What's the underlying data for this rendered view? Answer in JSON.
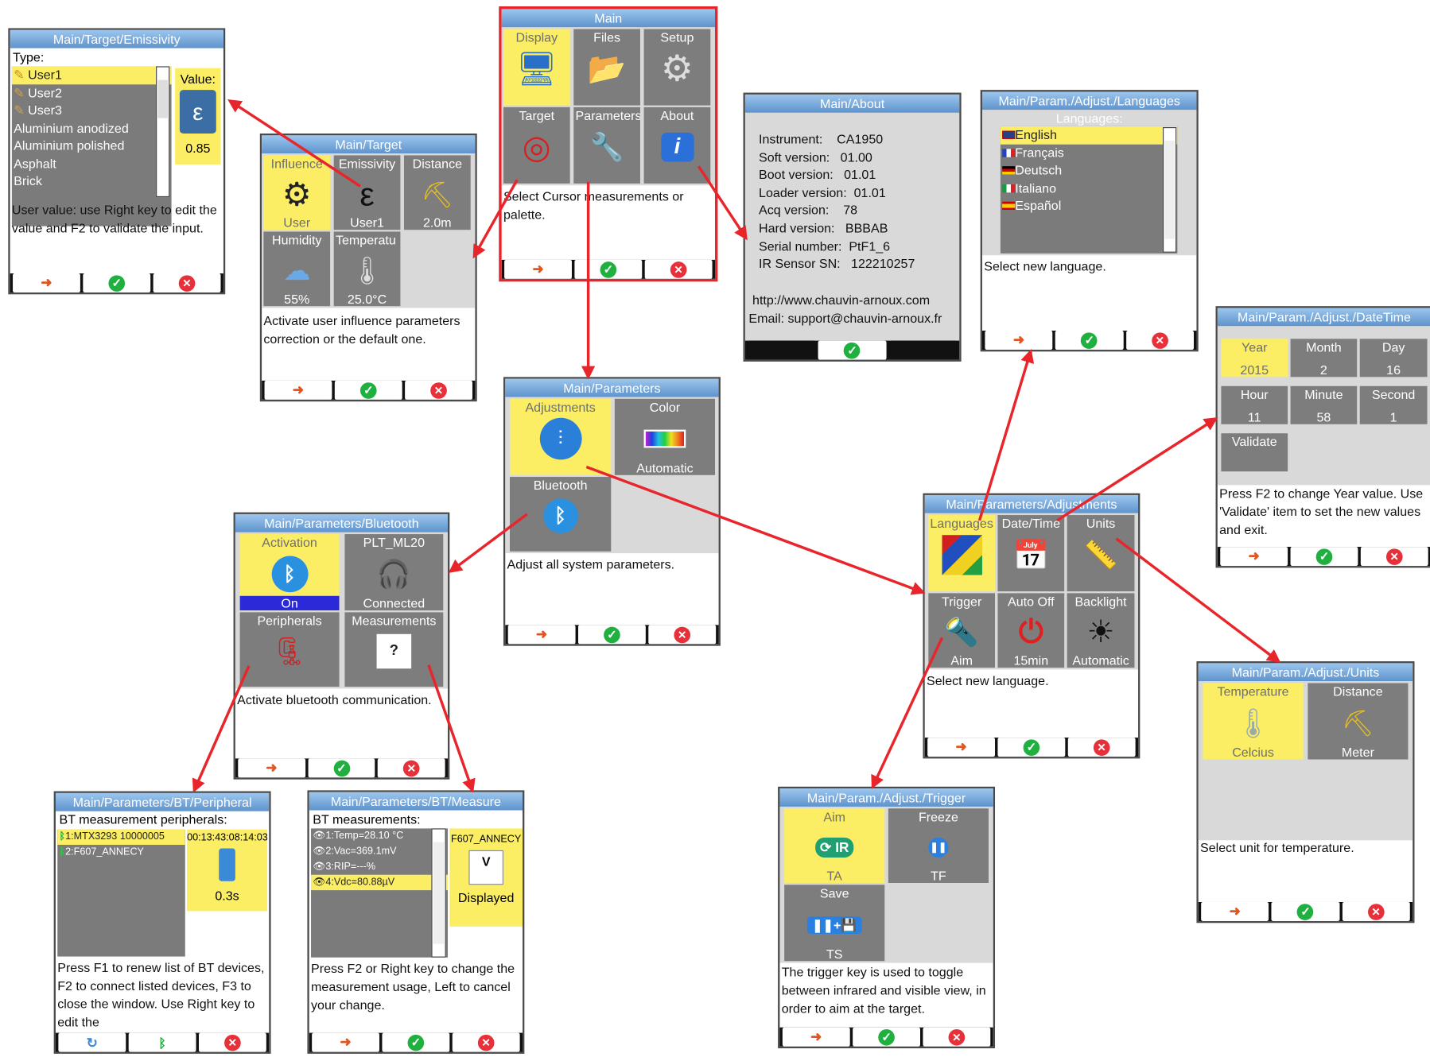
{
  "footer": {
    "exit": "exit-icon",
    "ok": "check-icon",
    "cancel": "cancel-icon",
    "refresh": "refresh-icon",
    "bt": "bluetooth-icon"
  },
  "main": {
    "title": "Main",
    "tiles": [
      {
        "label": "Display"
      },
      {
        "label": "Files"
      },
      {
        "label": "Setup"
      },
      {
        "label": "Target"
      },
      {
        "label": "Parameters"
      },
      {
        "label": "About"
      }
    ],
    "help": "Select Cursor measurements or palette."
  },
  "emissivity": {
    "title": "Main/Target/Emissivity",
    "type_label": "Type:",
    "items": [
      "User1",
      "User2",
      "User3",
      "Aluminium anodized",
      "Aluminium polished",
      "Asphalt",
      "Brick"
    ],
    "value_label": "Value:",
    "value": "0.85",
    "help": "User value: use Right key to edit the value and F2 to validate the input."
  },
  "target": {
    "title": "Main/Target",
    "tiles": [
      {
        "label": "Influence",
        "value": "User"
      },
      {
        "label": "Emissivity",
        "value": "User1"
      },
      {
        "label": "Distance",
        "value": "2.0m"
      },
      {
        "label": "Humidity",
        "value": "55%"
      },
      {
        "label": "Temperatu",
        "value": "25.0°C"
      }
    ],
    "help": "Activate user influence parameters correction or the default one."
  },
  "about": {
    "title": "Main/About",
    "lines": [
      "Instrument:    CA1950",
      "Soft version:   01.00",
      "Boot version:   01.01",
      "Loader version:  01.01",
      "Acq version:    78",
      "Hard version:   BBBAB",
      "Serial number:  PtF1_6",
      "IR Sensor SN:   122210257"
    ],
    "url": "http://www.chauvin-arnoux.com",
    "email": "Email: support@chauvin-arnoux.fr"
  },
  "languages": {
    "title": "Main/Param./Adjust./Languages",
    "header": "Languages:",
    "items": [
      "English",
      "Français",
      "Deutsch",
      "Italiano",
      "Español"
    ],
    "help": "Select new language."
  },
  "datetime": {
    "title": "Main/Param./Adjust./DateTime",
    "tiles": [
      {
        "label": "Year",
        "value": "2015"
      },
      {
        "label": "Month",
        "value": "2"
      },
      {
        "label": "Day",
        "value": "16"
      },
      {
        "label": "Hour",
        "value": "11"
      },
      {
        "label": "Minute",
        "value": "58"
      },
      {
        "label": "Second",
        "value": "1"
      },
      {
        "label": "Validate",
        "value": ""
      }
    ],
    "help": "Press F2 to change Year value. Use 'Validate' item to set the new values and exit."
  },
  "parameters": {
    "title": "Main/Parameters",
    "tiles": [
      {
        "label": "Adjustments",
        "value": ""
      },
      {
        "label": "Color",
        "value": "Automatic"
      },
      {
        "label": "Bluetooth",
        "value": ""
      }
    ],
    "help": "Adjust all system parameters."
  },
  "bluetooth": {
    "title": "Main/Parameters/Bluetooth",
    "tiles": [
      {
        "label": "Activation",
        "value": "On"
      },
      {
        "label": "PLT_ML20",
        "value": "Connected"
      },
      {
        "label": "Peripherals",
        "value": ""
      },
      {
        "label": "Measurements",
        "value": ""
      }
    ],
    "help": "Activate bluetooth communication."
  },
  "adjustments": {
    "title": "Main/Parameters/Adjustments",
    "tiles": [
      {
        "label": "Languages",
        "value": ""
      },
      {
        "label": "Date/Time",
        "value": ""
      },
      {
        "label": "Units",
        "value": ""
      },
      {
        "label": "Trigger",
        "value": "Aim"
      },
      {
        "label": "Auto Off",
        "value": "15min"
      },
      {
        "label": "Backlight",
        "value": "Automatic"
      }
    ],
    "help": "Select new language."
  },
  "units": {
    "title": "Main/Param./Adjust./Units",
    "tiles": [
      {
        "label": "Temperature",
        "value": "Celcius"
      },
      {
        "label": "Distance",
        "value": "Meter"
      }
    ],
    "help": "Select unit for temperature."
  },
  "peripheral": {
    "title": "Main/Parameters/BT/Peripheral",
    "header": "BT measurement peripherals:",
    "items": [
      "1:MTX3293 10000005",
      "2:F607_ANNECY"
    ],
    "time": "00:13:43:08:14:03",
    "value": "0.3s",
    "help": "Press F1 to renew list of BT devices, F2 to connect listed devices, F3 to close the window. Use Right key to edit the"
  },
  "measure": {
    "title": "Main/Parameters/BT/Measure",
    "header": "BT measurements:",
    "items": [
      "1:Temp=28.10 °C",
      "2:Vac=369.1mV",
      "3:RIP=---%",
      "4:Vdc=80.88µV"
    ],
    "device": "F607_ANNECY",
    "status": "Displayed",
    "help": "Press F2 or Right key to change the measurement usage, Left to cancel your change."
  },
  "trigger": {
    "title": "Main/Param./Adjust./Trigger",
    "tiles": [
      {
        "label": "Aim",
        "value": "TA"
      },
      {
        "label": "Freeze",
        "value": "TF"
      },
      {
        "label": "Save",
        "value": "TS"
      }
    ],
    "help": "The trigger key is used to toggle between infrared and visible view, in order to aim at the target."
  },
  "colors": {
    "arrow": "#e8252b",
    "selected": "#fbee64",
    "tile": "#7d7d7d",
    "title_bar": "#5e93cc"
  }
}
